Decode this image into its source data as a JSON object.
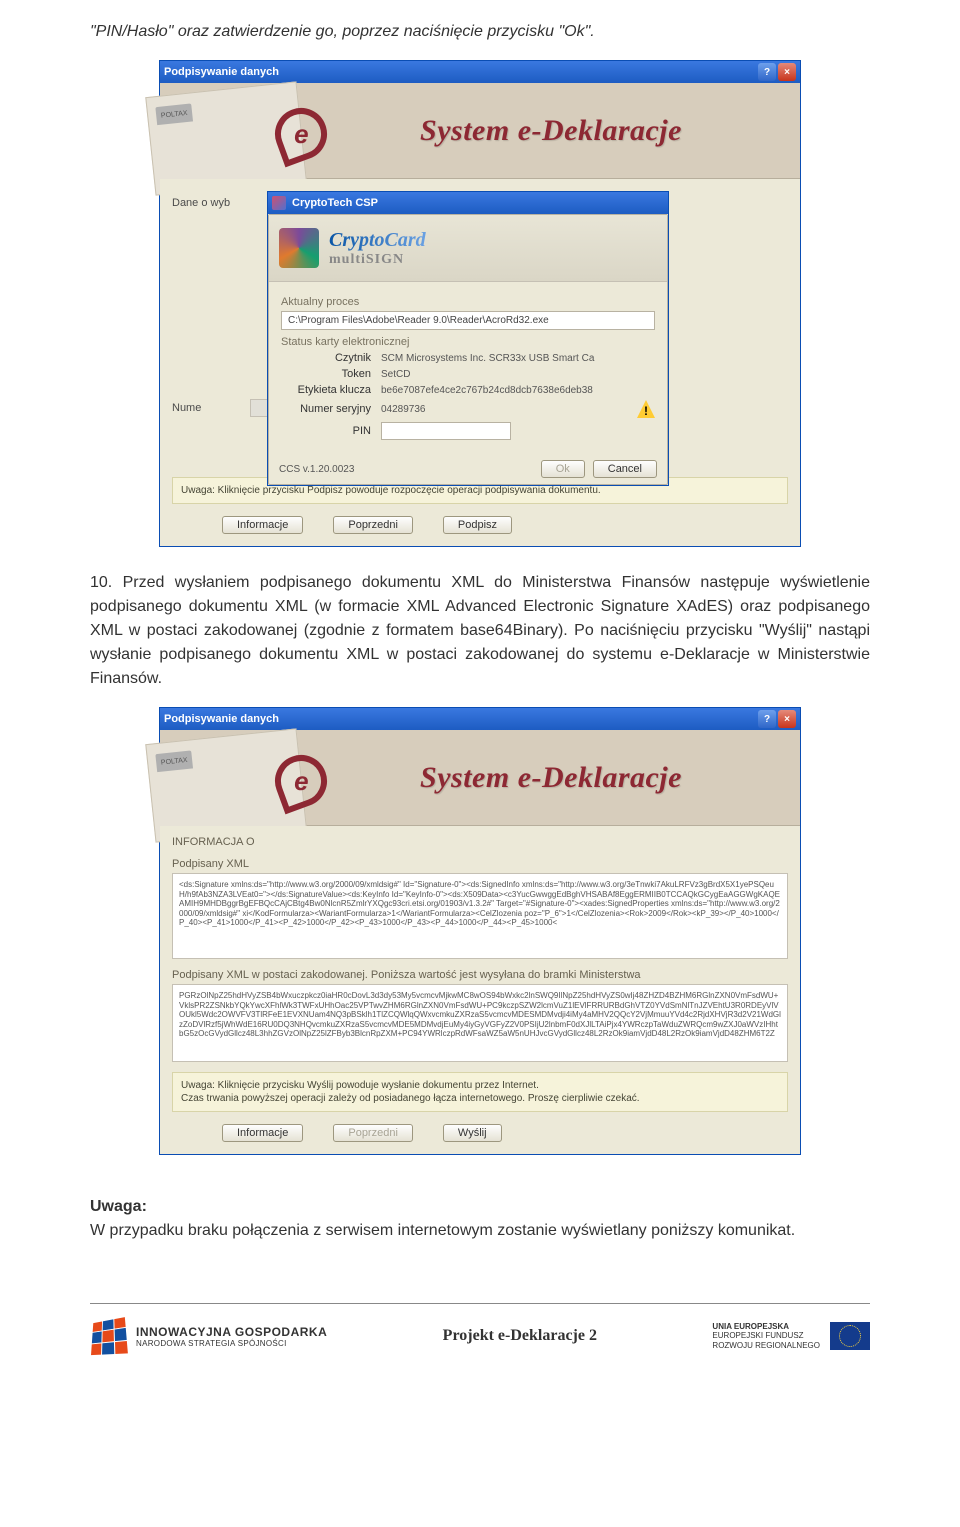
{
  "intro": {
    "line": "\"PIN/Hasło\" oraz zatwierdzenie go, poprzez naciśnięcie przycisku \"Ok\"."
  },
  "screenshot1": {
    "outer_title": "Podpisywanie danych",
    "banner_tab": "POLTAX",
    "banner_title": "System e-Deklaracje",
    "side_labels": {
      "dane": "Dane o wyb",
      "nume": "Nume"
    },
    "csp_title": "CryptoTech CSP",
    "cc_brand": "CryptoCard",
    "cc_sub": "multiSIGN",
    "aktualny": "Aktualny proces",
    "path": "C:\\Program Files\\Adobe\\Reader 9.0\\Reader\\AcroRd32.exe",
    "status": "Status karty elektronicznej",
    "rows": {
      "czytnik": {
        "k": "Czytnik",
        "v": "SCM Microsystems Inc. SCR33x USB Smart Ca"
      },
      "token": {
        "k": "Token",
        "v": "SetCD"
      },
      "etykieta": {
        "k": "Etykieta klucza",
        "v": "be6e7087efe4ce2c767b24cd8dcb7638e6deb38"
      },
      "numer": {
        "k": "Numer seryjny",
        "v": "04289736"
      },
      "pin": {
        "k": "PIN",
        "v": ""
      }
    },
    "version": "CCS v.1.20.0023",
    "ok": "Ok",
    "cancel": "Cancel",
    "warning": "Uwaga: Kliknięcie przycisku Podpisz powoduje rozpoczęcie operacji podpisywania dokumentu.",
    "btns": {
      "info": "Informacje",
      "prev": "Poprzedni",
      "sign": "Podpisz"
    }
  },
  "middle": {
    "text": "10. Przed wysłaniem podpisanego dokumentu XML do Ministerstwa Finansów następuje wyświetlenie podpisanego dokumentu XML (w formacie XML Advanced Electronic Signature XAdES) oraz podpisanego XML w postaci zakodowanej (zgodnie z formatem base64Binary). Po naciśnięciu przycisku \"Wyślij\" nastąpi wysłanie podpisanego dokumentu XML w postaci zakodowanej do systemu e-Deklaracje w Ministerstwie Finansów."
  },
  "screenshot2": {
    "outer_title": "Podpisywanie danych",
    "banner_title": "System e-Deklaracje",
    "banner_tab": "POLTAX",
    "info_title": "INFORMACJA O",
    "sec1": "Podpisany XML",
    "xml1": "<ds:Signature xmlns:ds=\"http://www.w3.org/2000/09/xmldsig#\" Id=\"Signature-0\"><ds:SignedInfo xmlns:ds=\"http://www.w3.org/3eTnwki7AkuLRFVz3gBrdX5X1yePSQeuH/h9fAb3NZA3LVEat0=\"></ds:SignatureValue><ds:KeyInfo Id=\"KeyInfo-0\"><ds:X509Data><c3YucGwwggEdBghVHSABAf8EggERMIIB0TCCAQkGCygEaAGGWgKAQEAMIH9MHDBggrBgEFBQcCAjCBtg4Bw0NlcnR5ZmlrYXQgc93cri.etsi.org/01903/v1.3.2#\" Target=\"#Signature-0\"><xades:SignedProperties xmlns:ds=\"http://www.w3.org/2000/09/xmldsig#\" xi</KodFormularza><WariantFormularza>1</WariantFormularza><CelZlozenia poz=\"P_6\">1</CelZlozenia><Rok>2009</Rok><kP_39></P_40>1000</P_40><P_41>1000</P_41><P_42>1000</P_42><P_43>1000</P_43><P_44>1000</P_44><P_45>1000<",
    "sec2": "Podpisany XML w postaci zakodowanej. Poniższa wartość jest wysyłana do bramki Ministerstwa",
    "xml2": "PGRzOlNpZ25hdHVyZSB4bWxuczpkcz0iaHR0cDovL3d3dy53My5vcmcvMjkwMC8wOS94bWxkc2lnSWQ9IlNpZ25hdHVyZS0wIj48ZHZD4BZHM6RGlnZXN0VmFsdWU+VklsPR2ZSNkbYQkYwcXFhlWk3TWFxUHhOac25VPTwvZHM6RGlnZXN0VmFsdWU+PC9kczpSZW2lcmVuZ1lEVlFRRURBdGhVTZ0YVdSmNlTnJZVEhtU3R0RDEyVlVOUkl5Wdc2OWVFV3TlRFeE1EVXNUam4NQ3pBSklh1TlZCQWlqQWxvcmkuZXRzaS5vcmcvMDESMDMvdji4iMy4aMHV2QQcY2VjMmuuYVd4c2RjdXHVjR3d2V21WdGlzZoDVlRzf5jWhWdE16RU0DQ3NHQvcmkuZXRzaS5vcmcvMDE5MDMvdjEuMy4iyGyVGFyZ2V0PSIjU2lnbmF0dXJlLTAiPjx4YWRczpTaWduZWRQcm9wZXJ0aWVzIHhtbG5zOcGVydGllcz48L3hhZGVzOlNpZ25lZFByb3BlcnRpZXM+PC94YWRlczpRdWFsaWZ5aW5nUHJvcGVydGllcz48L2RzOk9iamVjdD48L2RzOk9iamVjdD48ZHM6T2Z",
    "warning": "Uwaga: Kliknięcie przycisku Wyślij powoduje wysłanie dokumentu przez Internet.\nCzas trwania powyższej operacji zależy od posiadanego łącza internetowego. Proszę cierpliwie czekać.",
    "btns": {
      "info": "Informacje",
      "prev": "Poprzedni",
      "send": "Wyślij"
    }
  },
  "uwaga": {
    "head": "Uwaga:",
    "body": "W przypadku braku połączenia z serwisem internetowym zostanie wyświetlany poniższy komunikat."
  },
  "footer": {
    "ig1": "INNOWACYJNA GOSPODARKA",
    "ig2": "NARODOWA STRATEGIA SPÓJNOŚCI",
    "center": "Projekt e-Deklaracje 2",
    "eu1": "UNIA EUROPEJSKA",
    "eu2": "EUROPEJSKI FUNDUSZ",
    "eu3": "ROZWOJU REGIONALNEGO"
  }
}
